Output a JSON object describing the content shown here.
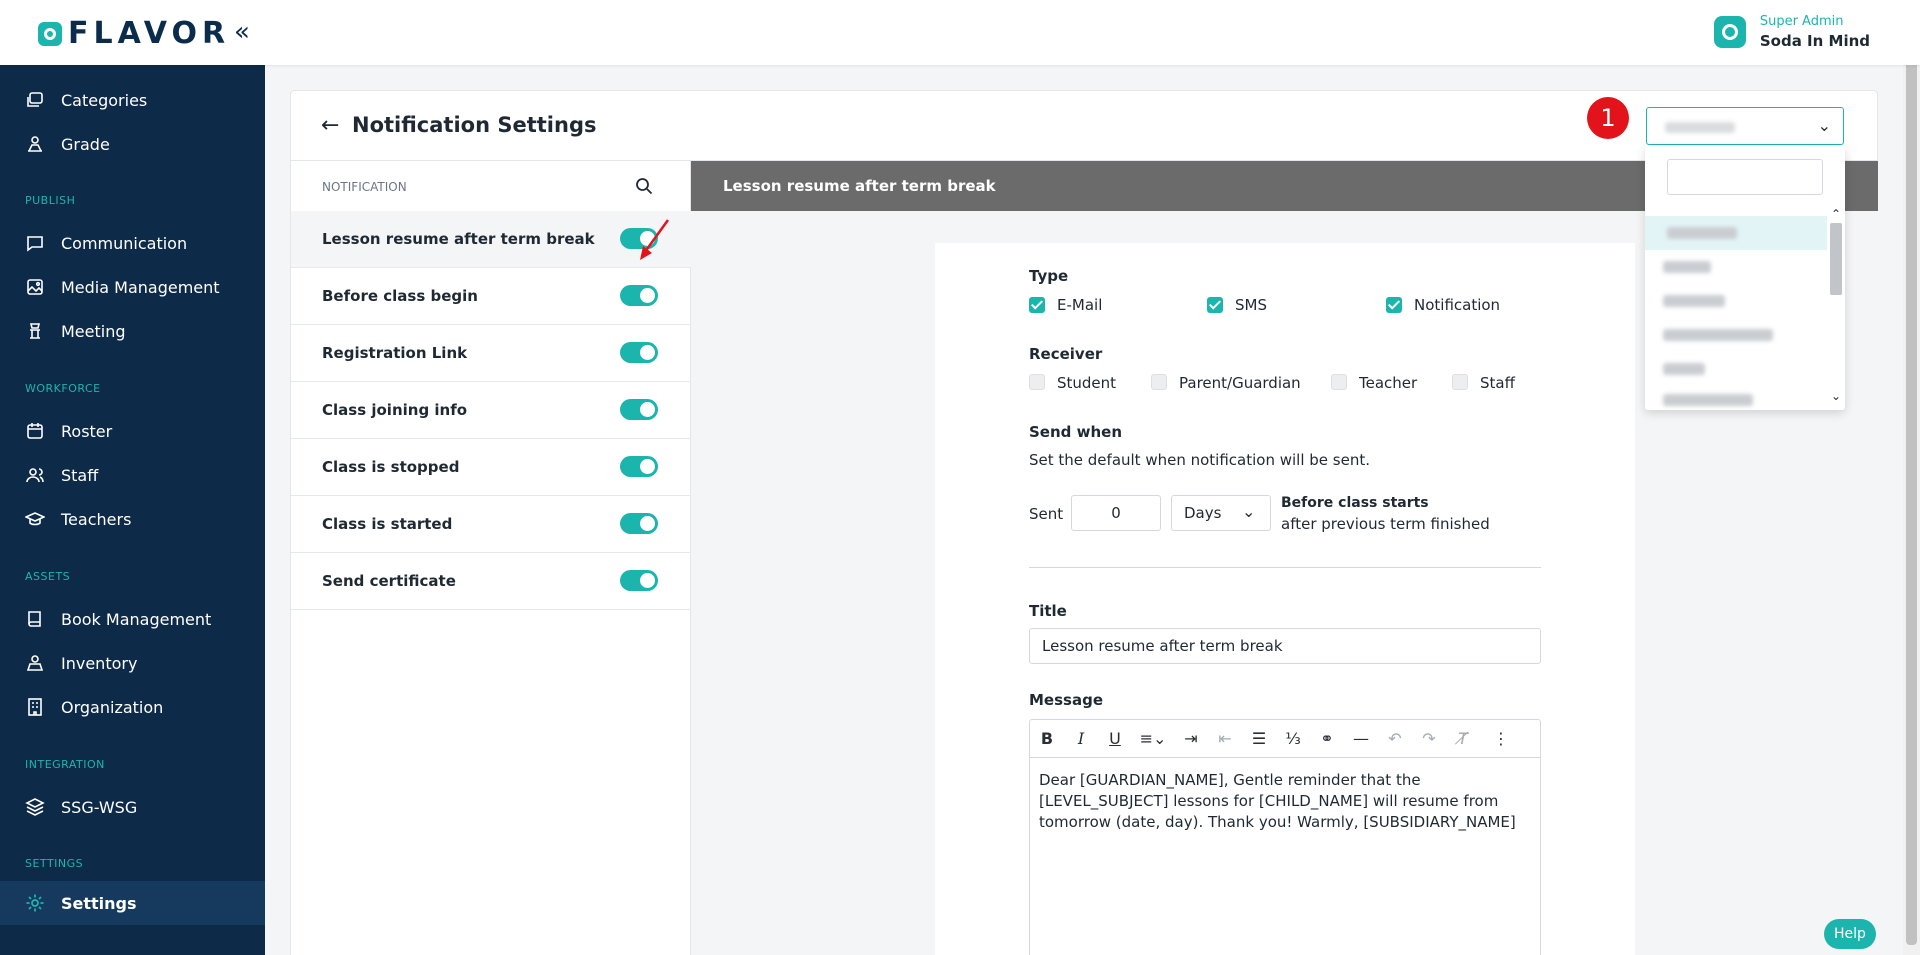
{
  "header": {
    "logo_text": "FLAVOR",
    "collapse_icon": "chevron-double-left-icon",
    "user_role": "Super Admin",
    "user_name": "Soda In Mind"
  },
  "sidebar": {
    "items": [
      {
        "label": "Categories",
        "icon": "categories-icon"
      },
      {
        "label": "Grade",
        "icon": "grade-icon"
      },
      {
        "label": "Communication",
        "icon": "communication-icon"
      },
      {
        "label": "Media Management",
        "icon": "media-icon"
      },
      {
        "label": "Meeting",
        "icon": "meeting-icon"
      },
      {
        "label": "Roster",
        "icon": "calendar-icon"
      },
      {
        "label": "Staff",
        "icon": "staff-icon"
      },
      {
        "label": "Teachers",
        "icon": "teachers-icon"
      },
      {
        "label": "Book Management",
        "icon": "book-icon"
      },
      {
        "label": "Inventory",
        "icon": "inventory-icon"
      },
      {
        "label": "Organization",
        "icon": "organization-icon"
      },
      {
        "label": "SSG-WSG",
        "icon": "layers-icon"
      },
      {
        "label": "Settings",
        "icon": "gear-icon",
        "active": true
      }
    ],
    "sections": {
      "publish": "PUBLISH",
      "workforce": "WORKFORCE",
      "assets": "ASSETS",
      "integration": "INTEGRATION",
      "settings": "SETTINGS"
    }
  },
  "page": {
    "title": "Notification Settings",
    "step_badge": "1"
  },
  "notification_list": {
    "header": "NOTIFICATION",
    "items": [
      {
        "label": "Lesson resume after term break",
        "enabled": true
      },
      {
        "label": "Before class begin",
        "enabled": true
      },
      {
        "label": "Registration Link",
        "enabled": true
      },
      {
        "label": "Class joining info",
        "enabled": true
      },
      {
        "label": "Class is stopped",
        "enabled": true
      },
      {
        "label": "Class is started",
        "enabled": true
      },
      {
        "label": "Send certificate",
        "enabled": true
      }
    ]
  },
  "detail": {
    "bar_title": "Lesson resume after term break",
    "type_label": "Type",
    "types": [
      {
        "label": "E-Mail",
        "checked": true
      },
      {
        "label": "SMS",
        "checked": true
      },
      {
        "label": "Notification",
        "checked": true
      }
    ],
    "receiver_label": "Receiver",
    "receivers": [
      {
        "label": "Student",
        "checked": false
      },
      {
        "label": "Parent/Guardian",
        "checked": false
      },
      {
        "label": "Teacher",
        "checked": false
      },
      {
        "label": "Staff",
        "checked": false
      }
    ],
    "send_when_label": "Send when",
    "send_when_desc": "Set the default when notification will be sent.",
    "sent_label": "Sent",
    "sent_value": "0",
    "unit_value": "Days",
    "before_label": "Before class starts",
    "after_label": "after previous term finished",
    "title_label": "Title",
    "title_value": "Lesson resume after term break",
    "message_label": "Message",
    "message_value": "Dear [GUARDIAN_NAME], Gentle reminder that the [LEVEL_SUBJECT] lessons for [CHILD_NAME] will resume from tomorrow (date, day). Thank you! Warmly, [SUBSIDIARY_NAME]"
  },
  "help_label": "Help",
  "colors": {
    "accent": "#1cb5ad",
    "sidebar_bg": "#0d2a49",
    "badge_red": "#e3131b",
    "detail_bar": "#6b6b6b"
  }
}
